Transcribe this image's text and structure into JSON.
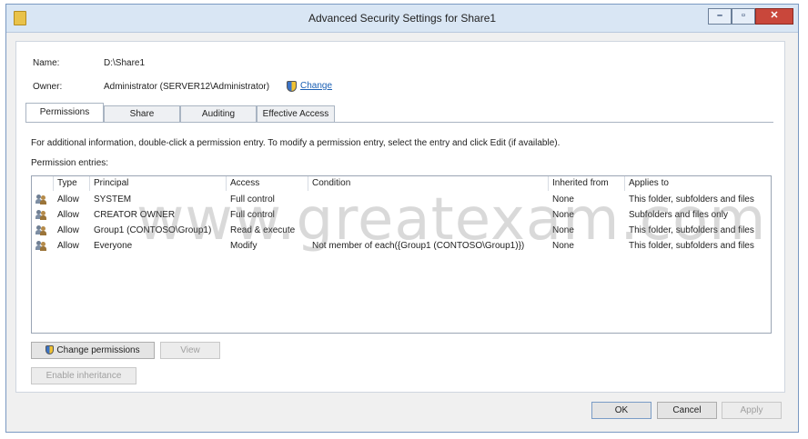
{
  "window": {
    "title": "Advanced Security Settings for Share1"
  },
  "info": {
    "name_label": "Name:",
    "name_value": "D:\\Share1",
    "owner_label": "Owner:",
    "owner_value": "Administrator (SERVER12\\Administrator)",
    "change_link": "Change"
  },
  "tabs": [
    {
      "label": "Permissions"
    },
    {
      "label": "Share"
    },
    {
      "label": "Auditing"
    },
    {
      "label": "Effective Access"
    }
  ],
  "help_text": "For additional information, double-click a permission entry. To modify a permission entry, select the entry and click Edit (if available).",
  "entries_label": "Permission entries:",
  "columns": {
    "type": "Type",
    "principal": "Principal",
    "access": "Access",
    "condition": "Condition",
    "inherited": "Inherited from",
    "applies": "Applies to"
  },
  "rows": [
    {
      "type": "Allow",
      "principal": "SYSTEM",
      "access": "Full control",
      "condition": "",
      "inherited": "None",
      "applies": "This folder, subfolders and files"
    },
    {
      "type": "Allow",
      "principal": "CREATOR OWNER",
      "access": "Full control",
      "condition": "",
      "inherited": "None",
      "applies": "Subfolders and files only"
    },
    {
      "type": "Allow",
      "principal": "Group1 (CONTOSO\\Group1)",
      "access": "Read & execute",
      "condition": "",
      "inherited": "None",
      "applies": "This folder, subfolders and files"
    },
    {
      "type": "Allow",
      "principal": "Everyone",
      "access": "Modify",
      "condition": "Not member of each({Group1 (CONTOSO\\Group1)})",
      "inherited": "None",
      "applies": "This folder, subfolders and files"
    }
  ],
  "buttons": {
    "change_permissions": "Change permissions",
    "view": "View",
    "enable_inheritance": "Enable inheritance",
    "ok": "OK",
    "cancel": "Cancel",
    "apply": "Apply"
  },
  "watermark": "www.greatexam.com"
}
